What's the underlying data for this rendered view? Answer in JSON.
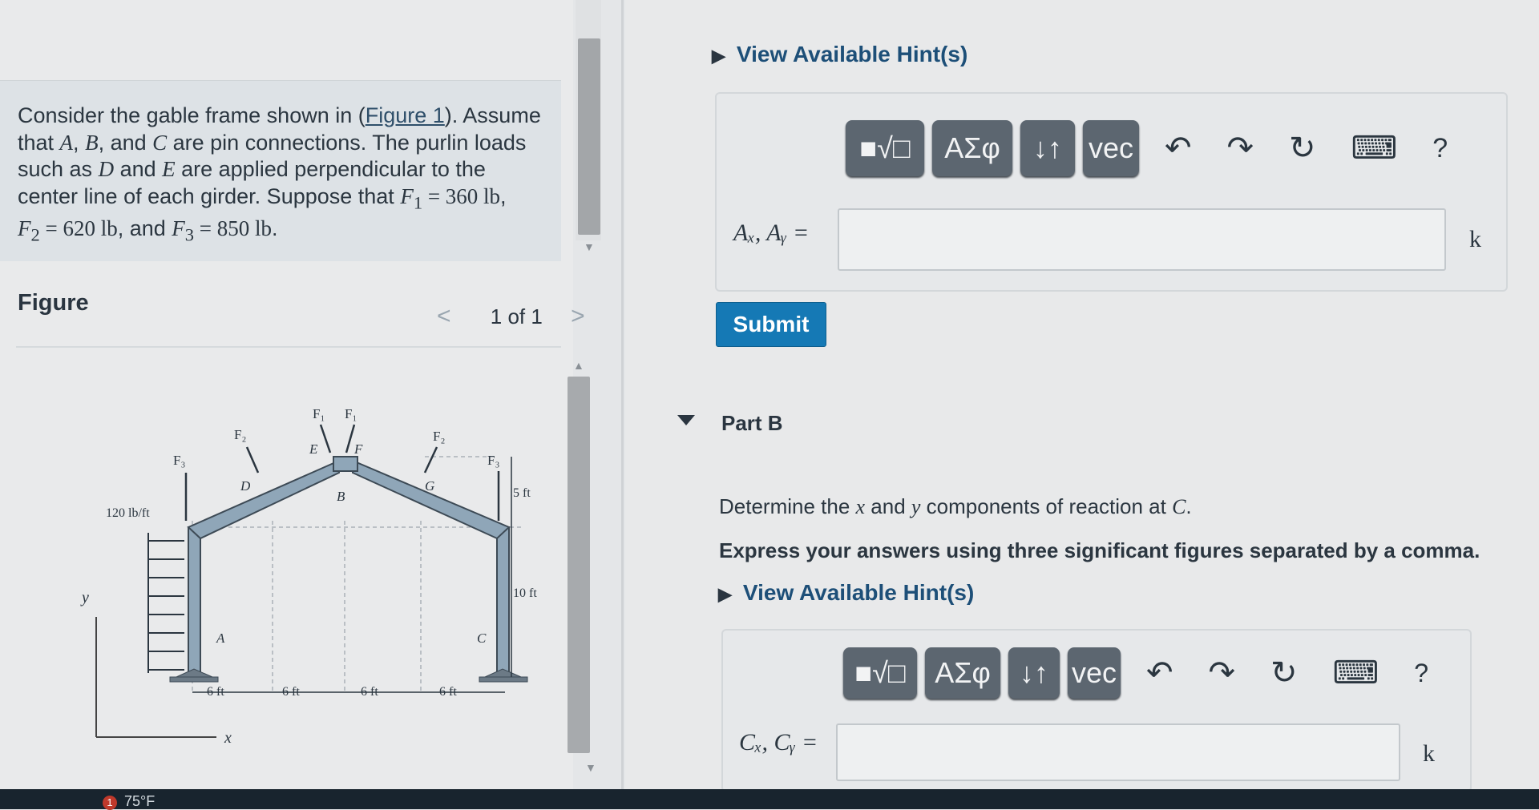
{
  "problem": {
    "p1": "Consider the gable frame shown in (",
    "figure_link": "Figure 1",
    "p2": "). Assume that ",
    "A": "A",
    "comma1": ", ",
    "B": "B",
    "p3": ", and ",
    "C": "C",
    "p4": " are pin connections. The purlin loads such as ",
    "D": "D",
    "p5": " and ",
    "E": "E",
    "p6": " are applied perpendicular to the center line of each girder. Suppose that ",
    "F1": "F",
    "F1_sub": "1",
    "F1_val": " = 360 lb",
    "p7": ", ",
    "F2": "F",
    "F2_sub": "2",
    "F2_val": " = 620 lb",
    "p8": ", and ",
    "F3": "F",
    "F3_sub": "3",
    "F3_val": " = 850 lb",
    "p9": "."
  },
  "figure": {
    "label": "Figure",
    "nav_prev": "<",
    "nav_text": "1 of 1",
    "nav_next": ">",
    "diagram": {
      "F1a": "F₁",
      "F1b": "F₁",
      "F2a": "F₂",
      "F2b": "F₂",
      "F3a": "F₃",
      "F3b": "F₃",
      "E": "E",
      "F": "F",
      "D": "D",
      "G": "G",
      "B": "B",
      "A": "A",
      "C": "C",
      "load": "120 lb/ft",
      "dim5": "5 ft",
      "dim10": "10 ft",
      "dim6a": "6 ft",
      "dim6b": "6 ft",
      "dim6c": "6 ft",
      "dim6d": "6 ft",
      "axis_y": "y",
      "axis_x": "x"
    }
  },
  "part_a": {
    "hint": "View Available Hint(s)",
    "toolbar": {
      "templates": "■√□",
      "greek": "ΑΣφ",
      "arrows": "↓↑",
      "vec": "vec",
      "help": "?"
    },
    "answer_label": "Aₓ, Aᵧ =",
    "answer_value": "",
    "unit": "k"
  },
  "submit_label": "Submit",
  "part_b": {
    "title": "Part B",
    "question_pre": "Determine the ",
    "x": "x",
    "question_mid": " and ",
    "y": "y",
    "question_mid2": " components of reaction at ",
    "C": "C",
    "question_end": ".",
    "instruction": "Express your answers using three significant figures separated by a comma.",
    "hint": "View Available Hint(s)",
    "toolbar": {
      "templates": "■√□",
      "greek": "ΑΣφ",
      "arrows": "↓↑",
      "vec": "vec",
      "help": "?"
    },
    "answer_label": "Cₓ, Cᵧ =",
    "answer_value": "",
    "unit": "k"
  },
  "taskbar": {
    "weather": "75°F",
    "badge": "1"
  }
}
